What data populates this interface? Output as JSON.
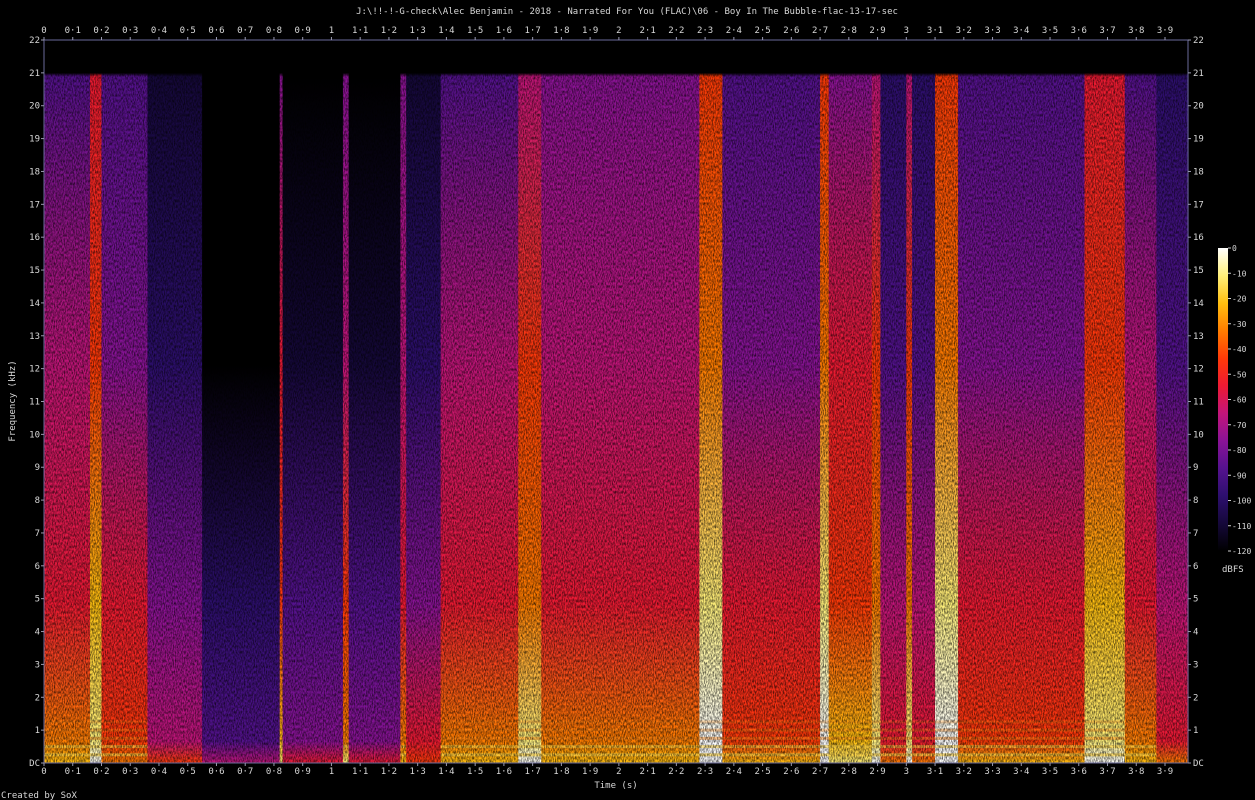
{
  "title": "J:\\!!-!-G-check\\Alec Benjamin - 2018 - Narrated For You (FLAC)\\06 - Boy In The Bubble-flac-13-17-sec",
  "footer": "Created by SoX",
  "chart_data": {
    "type": "heatmap",
    "title": "J:\\!!-!-G-check\\Alec Benjamin - 2018 - Narrated For You (FLAC)\\06 - Boy In The Bubble-flac-13-17-sec",
    "xlabel": "Time (s)",
    "ylabel": "Frequency (kHz)",
    "xlim": [
      0,
      3.98
    ],
    "ylim": [
      0,
      22
    ],
    "x_ticks": [
      "0",
      "0·1",
      "0·2",
      "0·3",
      "0·4",
      "0·5",
      "0·6",
      "0·7",
      "0·8",
      "0·9",
      "1",
      "1·1",
      "1·2",
      "1·3",
      "1·4",
      "1·5",
      "1·6",
      "1·7",
      "1·8",
      "1·9",
      "2",
      "2·1",
      "2·2",
      "2·3",
      "2·4",
      "2·5",
      "2·6",
      "2·7",
      "2·8",
      "2·9",
      "3",
      "3·1",
      "3·2",
      "3·3",
      "3·4",
      "3·5",
      "3·6",
      "3·7",
      "3·8",
      "3·9"
    ],
    "y_ticks": [
      "DC",
      "1",
      "2",
      "3",
      "4",
      "5",
      "6",
      "7",
      "8",
      "9",
      "10",
      "11",
      "12",
      "13",
      "14",
      "15",
      "16",
      "17",
      "18",
      "19",
      "20",
      "21",
      "22"
    ],
    "colorbar": {
      "label": "dBFS",
      "range": [
        -120,
        0
      ],
      "ticks": [
        "0",
        "-10",
        "-20",
        "-30",
        "-40",
        "-50",
        "-60",
        "-70",
        "-80",
        "-90",
        "-100",
        "-110",
        "-120"
      ]
    },
    "lowpass_cutoff_khz": 21,
    "palette": [
      "#000000",
      "#15083a",
      "#2d0f6e",
      "#55128f",
      "#8a1396",
      "#c3157a",
      "#ee1a33",
      "#ff3a08",
      "#ff7d00",
      "#ffbf10",
      "#fff07a",
      "#ffffff"
    ],
    "segments": [
      {
        "t": [
          0.0,
          0.16
        ],
        "level": 0.62
      },
      {
        "t": [
          0.16,
          0.2
        ],
        "level": 0.86
      },
      {
        "t": [
          0.2,
          0.36
        ],
        "level": 0.55
      },
      {
        "t": [
          0.36,
          0.55
        ],
        "level": 0.4
      },
      {
        "t": [
          0.55,
          0.82
        ],
        "level": 0.22
      },
      {
        "t": [
          0.82,
          0.83
        ],
        "level": 0.72
      },
      {
        "t": [
          0.83,
          1.04
        ],
        "level": 0.3
      },
      {
        "t": [
          1.04,
          1.06
        ],
        "level": 0.66
      },
      {
        "t": [
          1.06,
          1.24
        ],
        "level": 0.32
      },
      {
        "t": [
          1.24,
          1.26
        ],
        "level": 0.64
      },
      {
        "t": [
          1.26,
          1.38
        ],
        "level": 0.42
      },
      {
        "t": [
          1.38,
          1.65
        ],
        "level": 0.62
      },
      {
        "t": [
          1.65,
          1.73
        ],
        "level": 0.82
      },
      {
        "t": [
          1.73,
          2.28
        ],
        "level": 0.64
      },
      {
        "t": [
          2.28,
          2.36
        ],
        "level": 0.94
      },
      {
        "t": [
          2.36,
          2.7
        ],
        "level": 0.6
      },
      {
        "t": [
          2.7,
          2.73
        ],
        "level": 0.92
      },
      {
        "t": [
          2.73,
          2.88
        ],
        "level": 0.72
      },
      {
        "t": [
          2.88,
          2.91
        ],
        "level": 0.8
      },
      {
        "t": [
          2.91,
          3.0
        ],
        "level": 0.5
      },
      {
        "t": [
          3.0,
          3.02
        ],
        "level": 0.8
      },
      {
        "t": [
          3.02,
          3.1
        ],
        "level": 0.5
      },
      {
        "t": [
          3.1,
          3.18
        ],
        "level": 0.96
      },
      {
        "t": [
          3.18,
          3.62
        ],
        "level": 0.58
      },
      {
        "t": [
          3.62,
          3.76
        ],
        "level": 0.84
      },
      {
        "t": [
          3.76,
          3.87
        ],
        "level": 0.62
      },
      {
        "t": [
          3.87,
          3.98
        ],
        "level": 0.48
      }
    ]
  }
}
